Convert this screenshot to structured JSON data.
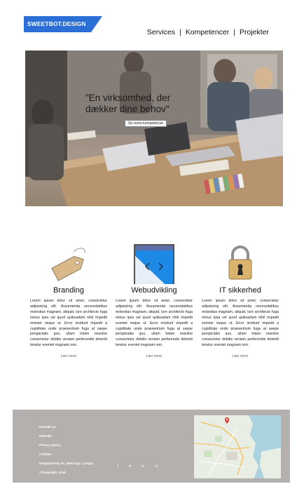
{
  "header": {
    "logo_text": "SWEETBOT.DESIGN",
    "nav": [
      {
        "label": "Services"
      },
      {
        "label": "Kompetencer"
      },
      {
        "label": "Projekter"
      }
    ],
    "separator": "|"
  },
  "hero": {
    "title": "\"En virksomhed, der dækker dine behov\"",
    "button_label": "Se vores kompetencer"
  },
  "services": [
    {
      "icon": "price-tag-icon",
      "title": "Branding",
      "text": "Lorem ipsum dolor sit amet, consectetur adipisicing elit. Assumenda necessitatibus molestias magnam, aliquid, iure architecto fuga minus ipsa vel quod quibusdam nihil impedit eveniet neque ut. Error incidunt impedit a cupiditate unde praesentium fuga at saepe perspiciatis quo, ullam totam maxime consectetur debitis veniam perferendis deleniti tenetur eveniet magnam non.",
      "more": "Læs mere"
    },
    {
      "icon": "browser-window-icon",
      "title": "Webudvikling",
      "text": "Lorem ipsum dolor sit amet, consectetur adipisicing elit. Assumenda necessitatibus molestias magnam, aliquid, iure architecto fuga minus ipsa vel quod quibusdam nihil impedit eveniet neque ut. Error incidunt impedit a cupiditate unde praesentium fuga at saepe perspiciatis quo, ullam totam maxime consectetur debitis veniam perferendis deleniti tenetur eveniet magnam non.",
      "more": "Læs mere"
    },
    {
      "icon": "padlock-icon",
      "title": "IT sikkerhed",
      "text": "Lorem ipsum dolor sit amet, consectetur adipisicing elit. Assumenda necessitatibus molestias magnam, aliquid, iure architecto fuga minus ipsa vel quod quibusdam nihil impedit eveniet neque ut. Error incidunt impedit a cupiditate unde praesentium fuga at saepe perspiciatis quo, ullam totam maxime consectetur debitis veniam perferendis deleniti tenetur eveniet magnam non.",
      "more": "Læs mere"
    }
  ],
  "footer": {
    "links": [
      {
        "label": "Kontakt os"
      },
      {
        "label": "Nyheder"
      },
      {
        "label": "Privacy policy"
      },
      {
        "label": "Cookies"
      }
    ],
    "address": "Nørgaardsvej 30, 2800 Kgs. Lyngby",
    "copyright": "©Copyright, 2018",
    "social": [
      {
        "icon": "facebook-icon",
        "glyph": "f"
      },
      {
        "icon": "twitter-icon",
        "glyph": "♥"
      },
      {
        "icon": "linkedin-icon",
        "glyph": "in"
      },
      {
        "icon": "instagram-icon",
        "glyph": "◎"
      }
    ]
  },
  "colors": {
    "logo_blue": "#2b6fd6",
    "footer_gray": "#b3b0ad",
    "browser_blue": "#1e88e5"
  }
}
